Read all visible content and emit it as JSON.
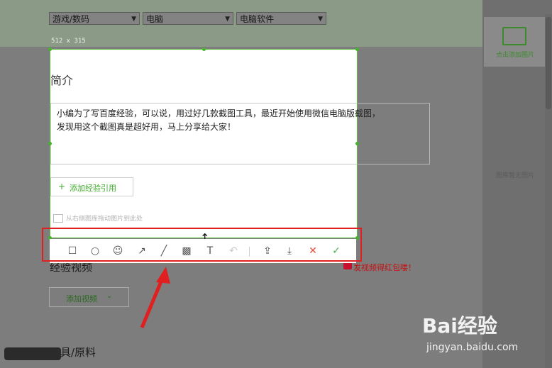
{
  "category_selects": [
    "游戏/数码",
    "电脑",
    "电脑软件"
  ],
  "capture_size": "512 x 315",
  "section_intro": "简介",
  "intro_text_line1": "小编为了写百度经验，可以说，用过好几款截图工具，最近开始使用微信电脑版截图，",
  "intro_text_line2": "发现用这个截图真是超好用，马上分享给大家！",
  "add_reference": "添加经验引用",
  "drag_hint": "从右侧图库拖动图片到此处",
  "section_video": "经验视频",
  "video_promo": "发视频得红包喽！",
  "add_video": "添加视频",
  "section_tools": "工具/原料",
  "add_image_label": "点击添加图片",
  "gallery_empty": "图库暂无图片",
  "toolbar": [
    {
      "name": "rectangle-tool-icon",
      "glyph": "☐"
    },
    {
      "name": "ellipse-tool-icon",
      "glyph": "○"
    },
    {
      "name": "emoji-tool-icon",
      "glyph": "☺"
    },
    {
      "name": "arrow-tool-icon",
      "glyph": "↗"
    },
    {
      "name": "pen-tool-icon",
      "glyph": "╱"
    },
    {
      "name": "mosaic-tool-icon",
      "glyph": "▩"
    },
    {
      "name": "text-tool-icon",
      "glyph": "T"
    },
    {
      "name": "undo-icon",
      "glyph": "↶"
    },
    {
      "name": "share-icon",
      "glyph": "⇪"
    },
    {
      "name": "download-icon",
      "glyph": "⤓"
    },
    {
      "name": "cancel-icon",
      "glyph": "✕"
    },
    {
      "name": "confirm-icon",
      "glyph": "✓"
    }
  ],
  "watermark_brand": "Bai经验",
  "watermark_url": "jingyan.baidu.com",
  "colors": {
    "accent": "#5dc13e",
    "red": "#e02020",
    "cancel": "#e74c3c",
    "confirm": "#4caf50"
  }
}
